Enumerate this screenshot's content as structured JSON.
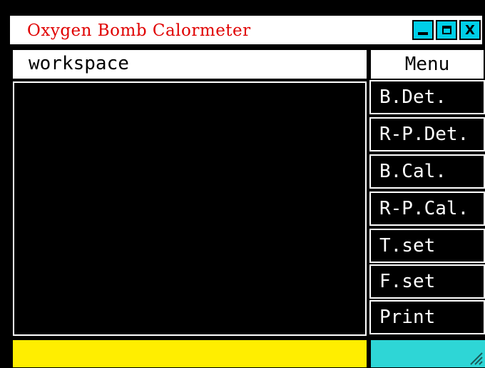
{
  "window": {
    "title": "Oxygen Bomb Calormeter",
    "controls": {
      "minimize_icon": "minimize-icon",
      "maximize_icon": "maximize-icon",
      "close_label": "X"
    }
  },
  "workspace": {
    "label": "workspace"
  },
  "menu": {
    "header": "Menu",
    "items": [
      {
        "label": "B.Det."
      },
      {
        "label": "R-P.Det."
      },
      {
        "label": "B.Cal."
      },
      {
        "label": "R-P.Cal."
      },
      {
        "label": "T.set"
      },
      {
        "label": "F.set"
      },
      {
        "label": "Print"
      }
    ]
  },
  "colors": {
    "title_text": "#e00000",
    "window_buttons": "#00cfe8",
    "status_left": "#ffee00",
    "status_right": "#2ed6d6",
    "background": "#000000"
  },
  "icons": {
    "resize_grip": "resize-grip-icon"
  }
}
